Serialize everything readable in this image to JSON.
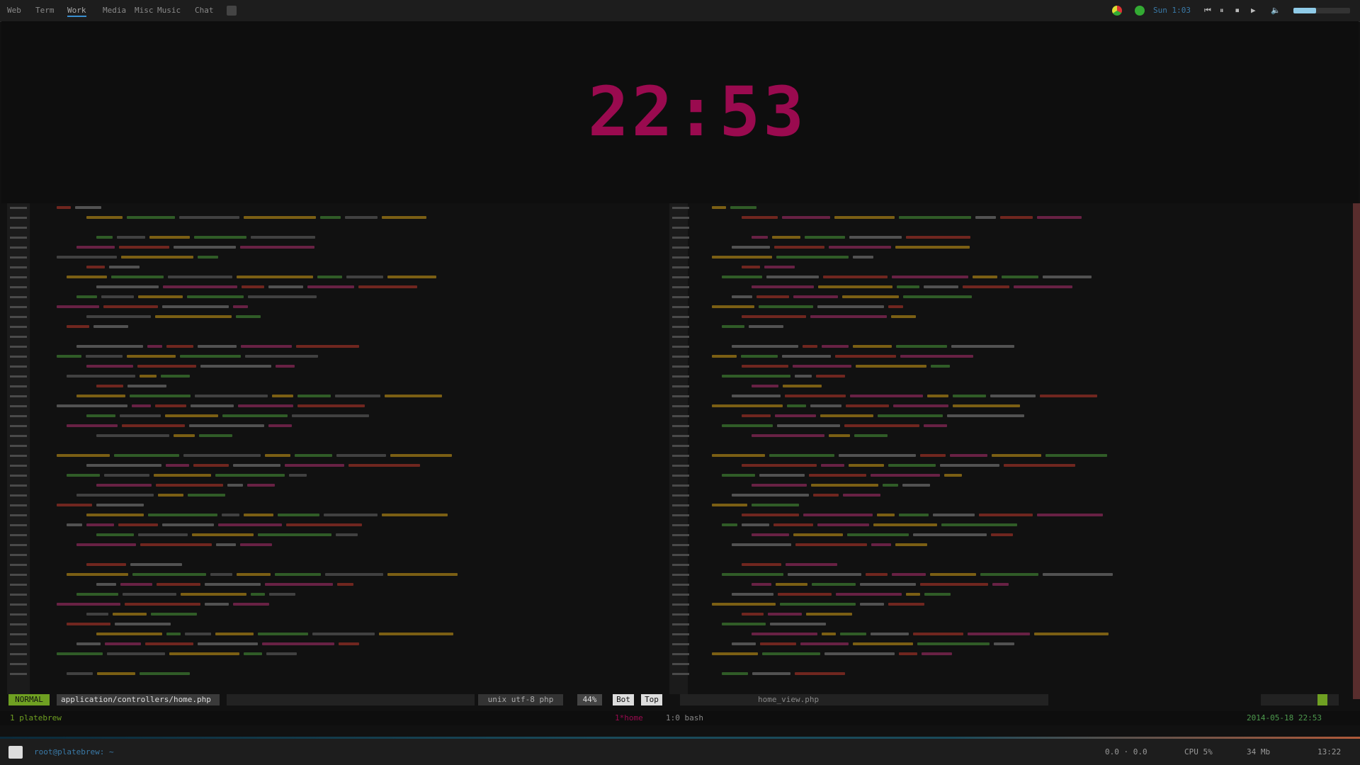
{
  "topbar": {
    "tabs": [
      "Web",
      "Term",
      "Work",
      "Media",
      "Misc",
      "Music",
      "Chat"
    ],
    "active_tab": "Work",
    "right_label": "Sun 1:03",
    "icons": [
      "chrome-icon",
      "shield-icon",
      "prev-icon",
      "play-icon",
      "next-icon",
      "volume-icon",
      "battery-icon"
    ]
  },
  "clock": {
    "time": "22:53",
    "color": "#9a0a4f"
  },
  "editor": {
    "left_file": "application/controllers/home.php",
    "right_file": "home_view.php",
    "filetype": "unix utf-8 php",
    "position": "44%",
    "mode": "NORMAL",
    "percent_a": "Bot",
    "percent_b": "Top"
  },
  "tmux": {
    "session": "1 platebrew",
    "window": "1*home",
    "window2": "1:0 bash",
    "datetime": "2014-05-18 22:53"
  },
  "taskbar": {
    "terminal_label": "root@platebrew: ~",
    "load": "0.0 · 0.0",
    "cpu": "CPU 5%",
    "mem": "34 Mb",
    "clock": "13:22"
  },
  "colors": {
    "accent": "#9a0a4f",
    "mode_green": "#6fa022",
    "active_tab_underline": "#3a8fd0"
  }
}
